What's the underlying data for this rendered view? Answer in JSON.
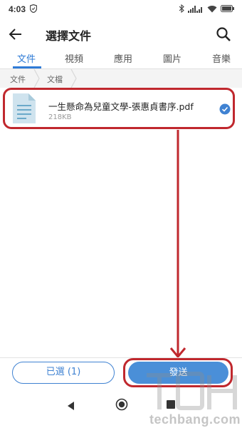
{
  "status_bar": {
    "time": "4:03"
  },
  "header": {
    "title": "選擇文件"
  },
  "tabs": [
    {
      "label": "文件"
    },
    {
      "label": "視頻"
    },
    {
      "label": "應用"
    },
    {
      "label": "圖片"
    },
    {
      "label": "音樂"
    }
  ],
  "breadcrumb": [
    "文件",
    "文檔"
  ],
  "file": {
    "name": "一生懸命為兒童文學-張惠貞書序.pdf",
    "size": "218KB",
    "selected": true
  },
  "footer": {
    "selected_label": "已選 (1)",
    "send_label": "發送"
  },
  "watermark": {
    "text": "techbang.com"
  },
  "colors": {
    "accent": "#2f7bd6",
    "highlight": "#c0282e",
    "send_bg": "#4a8fd8"
  }
}
